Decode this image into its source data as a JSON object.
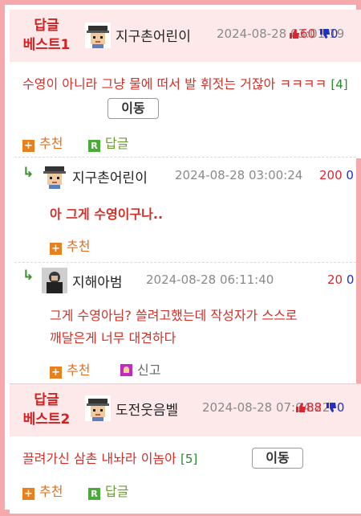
{
  "best1": {
    "label_line1": "답글",
    "label_line2": "베스트1",
    "nick": "지구촌어린이",
    "date": "2024-08-28 03:01:19",
    "up": "60",
    "down": "0",
    "content": "수영이 아니라 그냥 물에 떠서 발 휘젓는 거잖아 ㅋㅋㅋㅋ",
    "reply_count": "[4]",
    "move_label": "이동",
    "recommend_label": "추천",
    "reply_label": "답글"
  },
  "reply1": {
    "nick": "지구촌어린이",
    "date": "2024-08-28 03:00:24",
    "up": "200",
    "down": "0",
    "content": "아 그게 수영이구나..",
    "recommend_label": "추천"
  },
  "reply2": {
    "nick": "지해아범",
    "date": "2024-08-28 06:11:40",
    "up": "20",
    "down": "0",
    "content_line1": "그게 수영아님? 쓸려고했는데 작성자가 스스로",
    "content_line2": "깨달은게 너무 대견하다",
    "recommend_label": "추천",
    "report_label": "신고"
  },
  "best2": {
    "label_line1": "답글",
    "label_line2": "베스트2",
    "nick": "도전웃음벨",
    "date": "2024-08-28 07:04:22",
    "up": "88",
    "down": "0",
    "content": "끌려가신 삼촌 내놔라 이놈아",
    "reply_count": "[5]",
    "move_label": "이동",
    "recommend_label": "추천",
    "reply_label": "답글"
  },
  "icons": {
    "reply_arrow": "reply-arrow-icon",
    "thumb_up": "thumb-up-icon",
    "thumb_down": "thumb-down-icon",
    "plus": "plus-icon",
    "reply_r": "reply-icon",
    "report": "report-icon"
  },
  "colors": {
    "frame": "#f6a9ad",
    "best_bg": "#fde8ea",
    "accent_red": "#d32020",
    "up": "#e0242c",
    "down": "#2030c8",
    "recommend": "#e07020",
    "reply_green": "#4caa3a"
  }
}
